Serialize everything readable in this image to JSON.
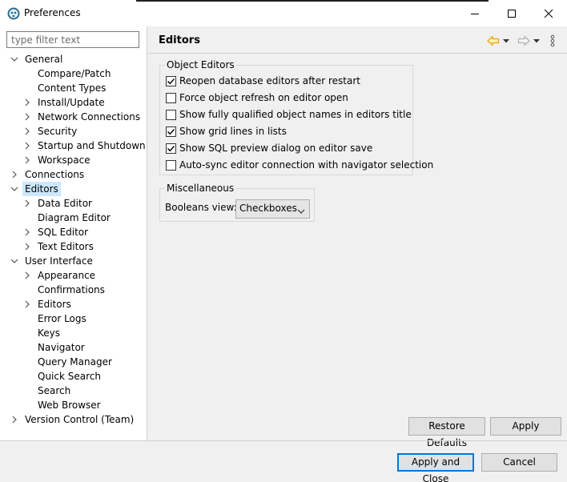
{
  "window": {
    "title": "Preferences"
  },
  "sidebar": {
    "filter_placeholder": "type filter text",
    "tree": [
      {
        "label": "General",
        "expander": "expanded"
      },
      {
        "label": "Compare/Patch",
        "expander": "none"
      },
      {
        "label": "Content Types",
        "expander": "none"
      },
      {
        "label": "Install/Update",
        "expander": "collapsed"
      },
      {
        "label": "Network Connections",
        "expander": "collapsed"
      },
      {
        "label": "Security",
        "expander": "collapsed"
      },
      {
        "label": "Startup and Shutdown",
        "expander": "collapsed"
      },
      {
        "label": "Workspace",
        "expander": "collapsed"
      },
      {
        "label": "Connections",
        "expander": "collapsed"
      },
      {
        "label": "Editors",
        "expander": "expanded",
        "selected": true
      },
      {
        "label": "Data Editor",
        "expander": "collapsed"
      },
      {
        "label": "Diagram Editor",
        "expander": "none"
      },
      {
        "label": "SQL Editor",
        "expander": "collapsed"
      },
      {
        "label": "Text Editors",
        "expander": "collapsed"
      },
      {
        "label": "User Interface",
        "expander": "expanded"
      },
      {
        "label": "Appearance",
        "expander": "collapsed"
      },
      {
        "label": "Confirmations",
        "expander": "none"
      },
      {
        "label": "Editors",
        "expander": "collapsed"
      },
      {
        "label": "Error Logs",
        "expander": "none"
      },
      {
        "label": "Keys",
        "expander": "none"
      },
      {
        "label": "Navigator",
        "expander": "none"
      },
      {
        "label": "Query Manager",
        "expander": "none"
      },
      {
        "label": "Quick Search",
        "expander": "none"
      },
      {
        "label": "Search",
        "expander": "none"
      },
      {
        "label": "Web Browser",
        "expander": "none"
      },
      {
        "label": "Version Control (Team)",
        "expander": "collapsed"
      }
    ]
  },
  "content": {
    "title": "Editors",
    "object_editors": {
      "label": "Object Editors",
      "options": [
        {
          "label": "Reopen database editors after restart",
          "checked": true
        },
        {
          "label": "Force object refresh on editor open",
          "checked": false
        },
        {
          "label": "Show fully qualified object names in editors title",
          "checked": false
        },
        {
          "label": "Show grid lines in lists",
          "checked": true
        },
        {
          "label": "Show SQL preview dialog on editor save",
          "checked": true
        },
        {
          "label": "Auto-sync editor connection with navigator selection",
          "checked": false
        }
      ]
    },
    "miscellaneous": {
      "label": "Miscellaneous",
      "booleans_label": "Booleans view:",
      "booleans_value": "Checkboxes"
    },
    "restore_defaults_label": "Restore Defaults",
    "apply_label": "Apply"
  },
  "footer": {
    "apply_close_label": "Apply and Close",
    "cancel_label": "Cancel"
  },
  "colors": {
    "accent": "#0078d7",
    "selection": "#cce8ff",
    "nav_back_arrow": "#e8a317"
  }
}
